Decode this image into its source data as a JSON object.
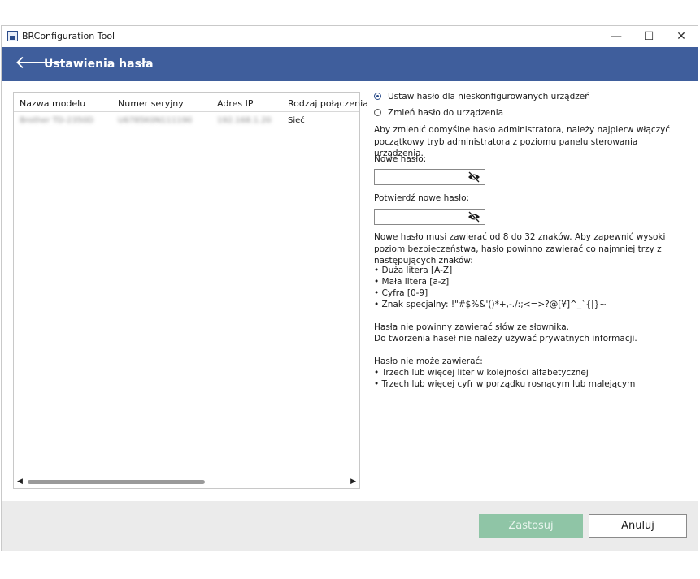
{
  "window": {
    "title": "BRConfiguration Tool",
    "min_label": "—",
    "max_label": "☐",
    "close_label": "✕"
  },
  "header": {
    "back_label": "🡐",
    "title": "Ustawienia hasła"
  },
  "table": {
    "columns": [
      "Nazwa modelu",
      "Numer seryjny",
      "Adres IP",
      "Rodzaj połączenia"
    ],
    "rows": [
      [
        "Brother TD-2350D",
        "U6785K0N111190",
        "192.168.1.20",
        "Sieć"
      ]
    ]
  },
  "options": {
    "option1": "Ustaw hasło dla nieskonfigurowanych urządzeń",
    "option2": "Zmień hasło do urządzenia",
    "selected": 1
  },
  "info": {
    "intro": "Aby zmienić domyślne hasło administratora, należy najpierw włączyć początkowy tryb administratora z poziomu panelu sterowania urządzenia.",
    "new_label": "Nowe hasło:",
    "confirm_label": "Potwierdź nowe hasło:",
    "requirements": "Nowe hasło musi zawierać od 8 do 32 znaków. Aby zapewnić wysoki poziom bezpieczeństwa, hasło powinno zawierać co najmniej trzy z następujących znaków:",
    "bullets": [
      "• Duża litera [A-Z]",
      "• Mała litera [a-z]",
      "• Cyfra [0-9]",
      "• Znak specjalny: !\"#$%&'()*+,-./:;<=>?@[¥]^_`{|}~"
    ],
    "dict1": "Hasła nie powinny zawierać słów ze słownika.",
    "dict2": "Do tworzenia haseł nie należy używać prywatnych informacji.",
    "cannot": "Hasło nie może zawierać:",
    "cannot_bullets": [
      "• Trzech lub więcej liter w kolejności alfabetycznej",
      "• Trzech lub więcej cyfr w porządku rosnącym lub malejącym"
    ]
  },
  "buttons": {
    "apply": "Zastosuj",
    "cancel": "Anuluj"
  },
  "scroll": {
    "left": "◀",
    "right": "▶"
  },
  "colors": {
    "header_bg": "#3f5e9c",
    "apply_bg": "#8fc5a6",
    "footer_bg": "#ebebeb"
  },
  "icons": {
    "eye": "eye-slash-icon",
    "back": "back-arrow-icon",
    "app": "app-icon"
  }
}
